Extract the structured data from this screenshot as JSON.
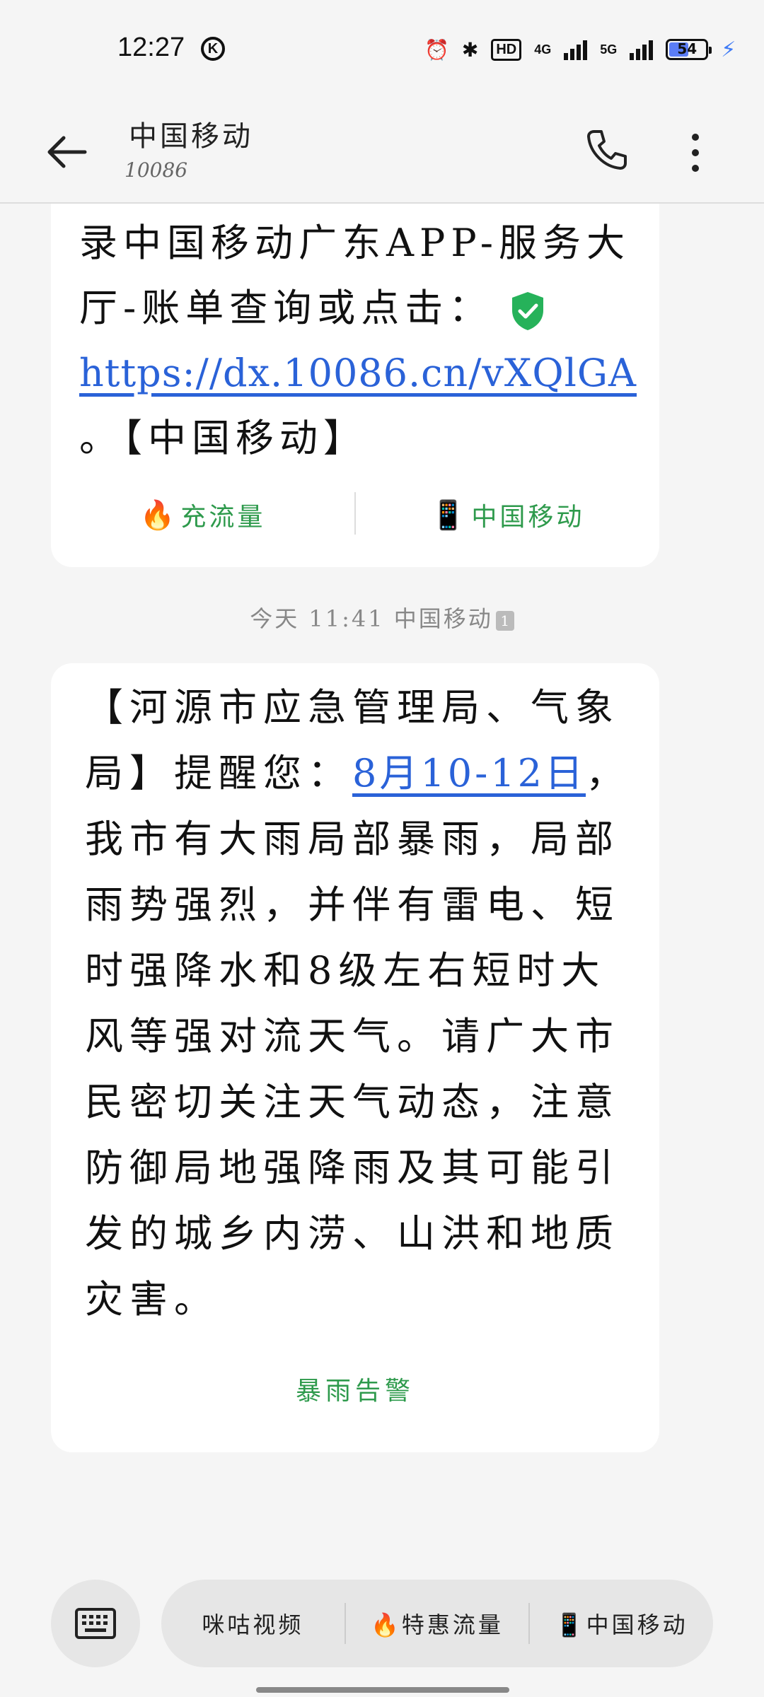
{
  "status_bar": {
    "time": "12:27",
    "k_label": "K",
    "hd_label": "HD",
    "net1": "4G",
    "net2": "5G",
    "battery": "54",
    "battery_level_percent": 54
  },
  "header": {
    "sender": "中国移动",
    "number": "10086"
  },
  "messages": [
    {
      "text_before_link": "录中国移动广东APP-服务大厅-账单查询或点击：",
      "link": "https://dx.10086.cn/vXQlGA",
      "text_after_link": "。【中国移动】",
      "actions": [
        {
          "icon": "fire-icon",
          "emoji": "🔥",
          "label": "充流量"
        },
        {
          "icon": "phone-device-icon",
          "emoji": "📱",
          "label": "中国移动"
        }
      ]
    },
    {
      "timestamp": "今天 11:41 中国移动",
      "sim": "1",
      "text_before_link": "【河源市应急管理局、气象局】提醒您：",
      "link": "8月10-12日",
      "text_after_link": "，我市有大雨局部暴雨，局部雨势强烈，并伴有雷电、短时强降水和8级左右短时大风等强对流天气。请广大市民密切关注天气动态，注意防御局地强降雨及其可能引发的城乡内涝、山洪和地质灾害。",
      "action": "暴雨告警"
    }
  ],
  "quick_replies": [
    {
      "emoji": "",
      "label": "咪咕视频"
    },
    {
      "emoji": "🔥",
      "label": "特惠流量"
    },
    {
      "emoji": "📱",
      "label": "中国移动"
    }
  ],
  "colors": {
    "accent_green": "#2e9a4c",
    "link_blue": "#2a62d8",
    "shield_green": "#26b25a"
  }
}
